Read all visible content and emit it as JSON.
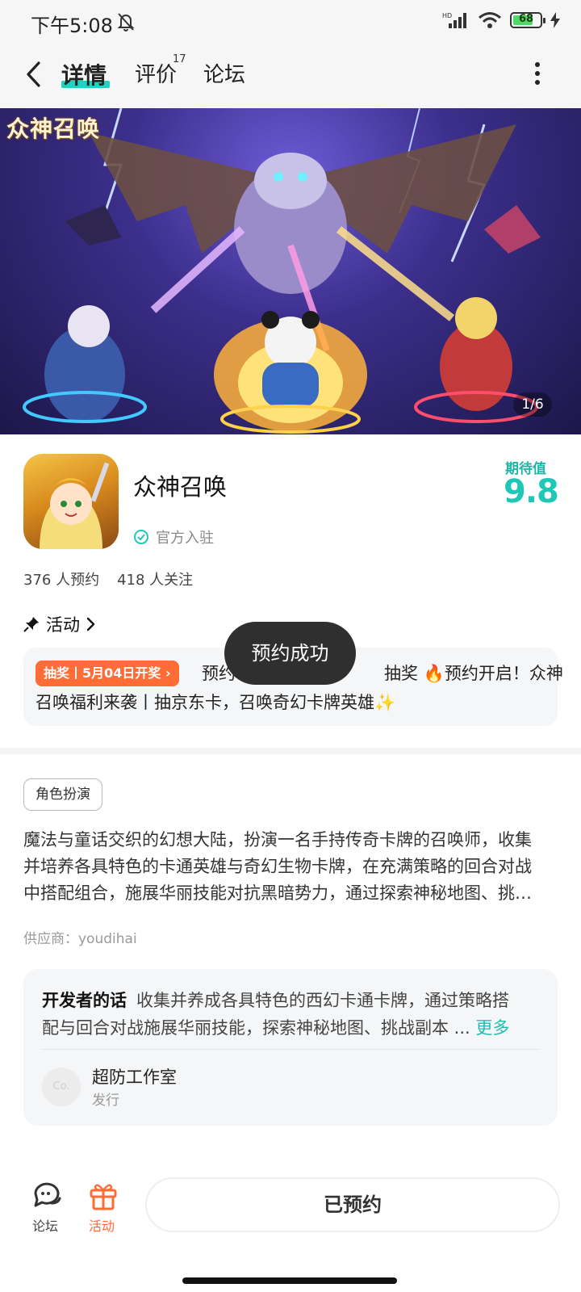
{
  "status_bar": {
    "time": "下午5:08",
    "battery": "68",
    "signal_tag": "HD"
  },
  "nav": {
    "tabs": [
      {
        "label": "详情",
        "active": true
      },
      {
        "label": "评价",
        "badge": "17"
      },
      {
        "label": "论坛"
      }
    ]
  },
  "hero": {
    "logo_text": "众神召唤",
    "counter": "1/6"
  },
  "app": {
    "name": "众神召唤",
    "official_label": "官方入驻",
    "expect_label": "期待值",
    "expect_value": "9.8",
    "reservations": "376 人预约",
    "followers": "418 人关注"
  },
  "activity": {
    "header": "活动",
    "tag": "抽奖丨5月04日开奖",
    "line1_prefix": "预约",
    "line1_suffix": "抽奖 🔥预约开启！众神",
    "line2": "召唤福利来袭丨抽京东卡，召唤奇幻卡牌英雄✨"
  },
  "toast": "预约成功",
  "genre_tag": "角色扮演",
  "description": [
    "魔法与童话交织的幻想大陆，扮演一名手持传奇卡牌的召唤师，收集",
    "并培养各具特色的卡通英雄与奇幻生物卡牌，在充满策略的回合对战",
    "中搭配组合，施展华丽技能对抗黑暗势力，通过探索神秘地图、挑…"
  ],
  "supplier": "供应商：youdihai",
  "developer": {
    "title": "开发者的话",
    "text_line1": "收集并养成各具特色的西幻卡通卡牌，通过策略搭",
    "text_line2": "配与回合对战施展华丽技能，探索神秘地图、挑战副本 ... ",
    "more": "更多",
    "avatar_text": "Co.",
    "studio": "超防工作室",
    "role": "发行"
  },
  "bottom": {
    "forum_label": "论坛",
    "activity_label": "活动",
    "reserved_button": "已预约"
  },
  "colors": {
    "accent": "#1fc7b6",
    "orange": "#ff6c36",
    "toast_bg": "#2f2f2f"
  }
}
